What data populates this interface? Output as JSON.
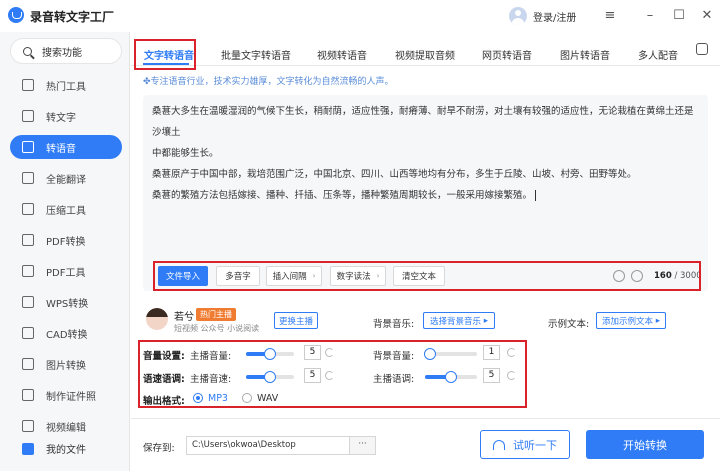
{
  "app": {
    "title": "录音转文字工厂",
    "login": "登录/注册"
  },
  "sidebar": {
    "search": "搜索功能",
    "items": [
      {
        "label": "热门工具",
        "icon": "fire-icon"
      },
      {
        "label": "转文字",
        "icon": "text-convert-icon"
      },
      {
        "label": "转语音",
        "icon": "speech-icon",
        "active": true
      },
      {
        "label": "全能翻译",
        "icon": "translate-icon"
      },
      {
        "label": "压缩工具",
        "icon": "compress-icon"
      },
      {
        "label": "PDF转换",
        "icon": "pdf-convert-icon"
      },
      {
        "label": "PDF工具",
        "icon": "pdf-tools-icon"
      },
      {
        "label": "WPS转换",
        "icon": "wps-icon"
      },
      {
        "label": "CAD转换",
        "icon": "cad-icon"
      },
      {
        "label": "图片转换",
        "icon": "image-convert-icon"
      },
      {
        "label": "制作证件照",
        "icon": "id-photo-icon"
      },
      {
        "label": "视频编辑",
        "icon": "video-edit-icon"
      }
    ],
    "my_files": "我的文件"
  },
  "tabs": [
    "文字转语音",
    "批量文字转语音",
    "视频转语音",
    "视频提取音频",
    "网页转语音",
    "图片转语音",
    "多人配音"
  ],
  "slogan": "专注语音行业，技术实力雄厚，文字转化为自然流畅的人声。",
  "editor": {
    "lines": [
      "桑葚大多生在温暖湿润的气候下生长，稍耐荫，适应性强，耐瘠薄、耐旱不耐涝，对土壤有较强的适应性，无论栽植在黄绵土还是沙壤土",
      "中都能够生长。",
      "桑葚原产于中国中部，栽培范围广泛，中国北京、四川、山西等地均有分布，多生于丘陵、山坡、村旁、田野等处。",
      "桑葚的繁殖方法包括嫁接、播种、扦插、压条等，播种繁殖周期较长，一般采用嫁接繁殖。"
    ]
  },
  "toolbar": {
    "import": "文件导入",
    "polyphone": "多音字",
    "pause": "插入间隔",
    "number_reading": "数字读法",
    "clear": "清空文本",
    "char_count": "160",
    "char_limit": "/ 3000"
  },
  "anchor": {
    "name": "若兮",
    "badge": "热门主播",
    "tags": "短视频  公众号  小说阅读",
    "change_button": "更换主播"
  },
  "bg_music": {
    "label": "背景音乐:",
    "button": "选择背景音乐"
  },
  "sample": {
    "label": "示例文本:",
    "button": "添加示例文本"
  },
  "settings": {
    "volume_label": "音量设置:",
    "speed_label": "语速语调:",
    "format_label": "输出格式:",
    "anchor_volume": {
      "label": "主播音量:",
      "value": "5",
      "level": 0.5
    },
    "bg_volume": {
      "label": "背景音量:",
      "value": "1",
      "level": 0.1
    },
    "anchor_speed": {
      "label": "主播音速:",
      "value": "5",
      "level": 0.5
    },
    "anchor_tone": {
      "label": "主播语调:",
      "value": "5",
      "level": 0.5
    },
    "formats": [
      "MP3",
      "WAV"
    ],
    "selected_format": "MP3"
  },
  "footer": {
    "save_label": "保存到:",
    "path": "C:\\Users\\okwoa\\Desktop",
    "browse": "···",
    "listen": "试听一下",
    "start": "开始转换"
  },
  "colors": {
    "accent": "#2f7cf6",
    "highlight": "#d9222a",
    "badge": "#f07c32"
  }
}
